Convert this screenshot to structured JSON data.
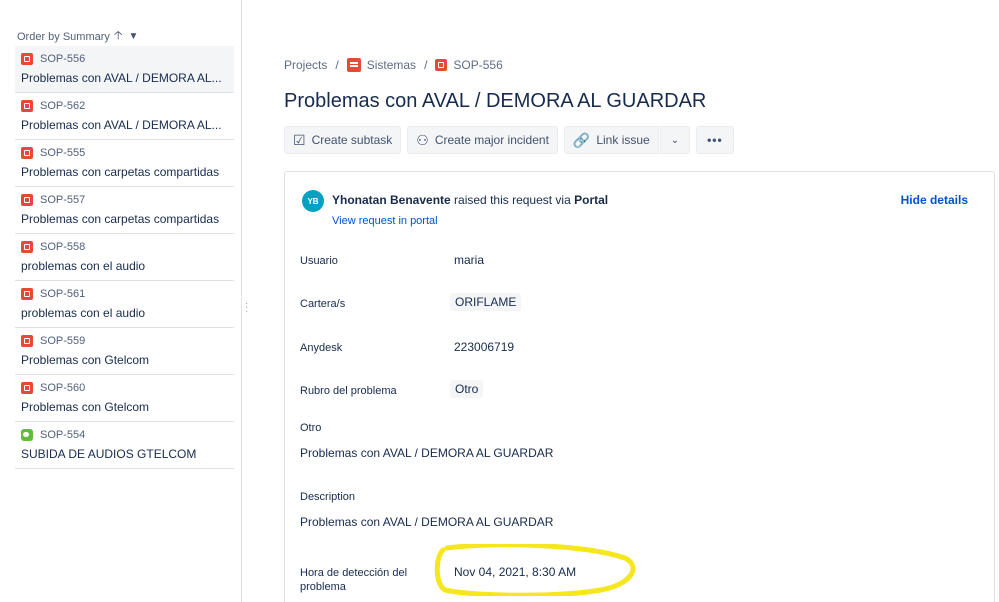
{
  "sidebar": {
    "order_label": "Order by Summary",
    "items": [
      {
        "key": "SOP-556",
        "summary": "Problemas con AVAL / DEMORA AL...",
        "type": "incident"
      },
      {
        "key": "SOP-562",
        "summary": "Problemas con AVAL / DEMORA AL...",
        "type": "incident"
      },
      {
        "key": "SOP-555",
        "summary": "Problemas con carpetas compartidas",
        "type": "incident"
      },
      {
        "key": "SOP-557",
        "summary": "Problemas con carpetas compartidas",
        "type": "incident"
      },
      {
        "key": "SOP-558",
        "summary": "problemas con el audio",
        "type": "incident"
      },
      {
        "key": "SOP-561",
        "summary": "problemas con el audio",
        "type": "incident"
      },
      {
        "key": "SOP-559",
        "summary": "Problemas con Gtelcom",
        "type": "incident"
      },
      {
        "key": "SOP-560",
        "summary": "Problemas con Gtelcom",
        "type": "incident"
      },
      {
        "key": "SOP-554",
        "summary": "SUBIDA DE AUDIOS GTELCOM",
        "type": "service-request"
      }
    ]
  },
  "breadcrumb": {
    "projects": "Projects",
    "project": "Sistemas",
    "issue": "SOP-556"
  },
  "issue": {
    "title": "Problemas con AVAL / DEMORA AL GUARDAR"
  },
  "toolbar": {
    "create_subtask": "Create subtask",
    "create_major_incident": "Create major incident",
    "link_issue": "Link issue"
  },
  "request": {
    "avatar_initials": "YB",
    "reporter": "Yhonatan Benavente",
    "raised_text": "raised this request via",
    "channel": "Portal",
    "view_portal": "View request in portal",
    "hide_details": "Hide details"
  },
  "fields": {
    "usuario_label": "Usuario",
    "usuario_value": "maria",
    "cartera_label": "Cartera/s",
    "cartera_value": "ORIFLAME",
    "anydesk_label": "Anydesk",
    "anydesk_value": "223006719",
    "rubro_label": "Rubro del problema",
    "rubro_value": "Otro",
    "otro_label": "Otro",
    "otro_value": "Problemas con AVAL / DEMORA AL GUARDAR",
    "description_label": "Description",
    "description_value": "Problemas con AVAL / DEMORA AL GUARDAR",
    "hora_label": "Hora de detección del problema",
    "hora_value": "Nov 04, 2021, 8:30 AM"
  },
  "colors": {
    "accent": "#0052cc",
    "incident": "#e5493a",
    "service_request": "#63ba3c",
    "highlight": "#f5e61d"
  }
}
